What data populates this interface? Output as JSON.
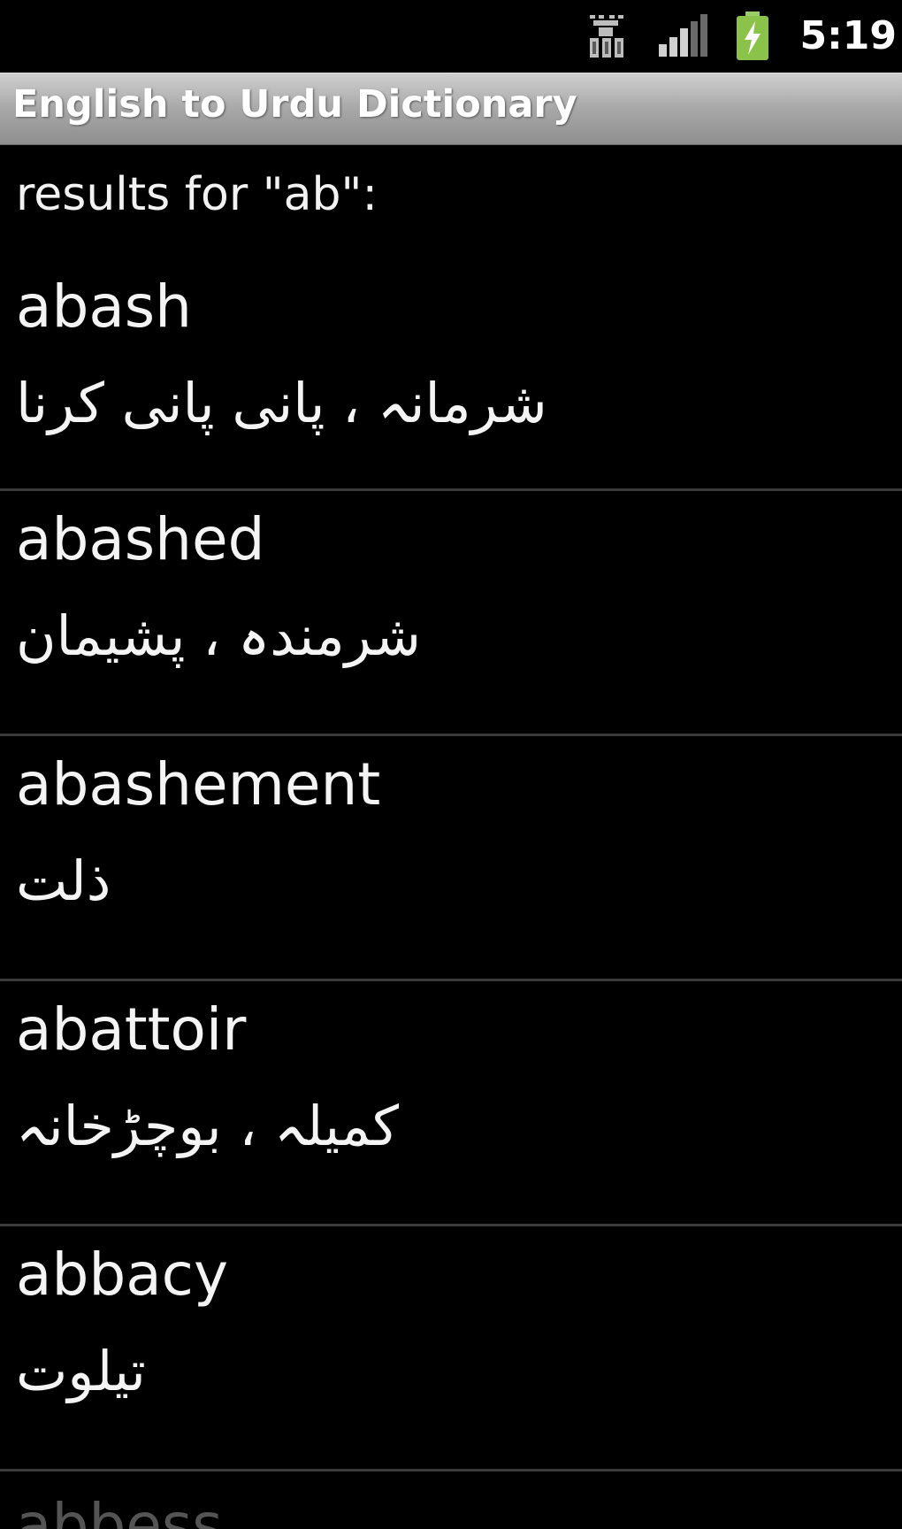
{
  "status_bar": {
    "time": "5:19",
    "icons": [
      "usb-debug-icon",
      "signal-strength-icon",
      "battery-charging-icon"
    ],
    "battery_color": "#8bc34a"
  },
  "app": {
    "title": "English to Urdu Dictionary"
  },
  "results": {
    "header": "results for \"ab\":",
    "items": [
      {
        "word": "abash",
        "meaning": "شرمانہ ، پانی پانی کرنا"
      },
      {
        "word": "abashed",
        "meaning": "شرمندہ ، پشیمان"
      },
      {
        "word": "abashement",
        "meaning": "ذلت"
      },
      {
        "word": "abattoir",
        "meaning": "کمیلہ ، بوچڑخانہ"
      },
      {
        "word": "abbacy",
        "meaning": "تیلوت"
      },
      {
        "word": "abbess",
        "meaning": ""
      }
    ]
  },
  "colors": {
    "background": "#000000",
    "title_bar": "#a9a9a9",
    "divider": "#3b3b3b",
    "text": "#f4f4f4"
  }
}
